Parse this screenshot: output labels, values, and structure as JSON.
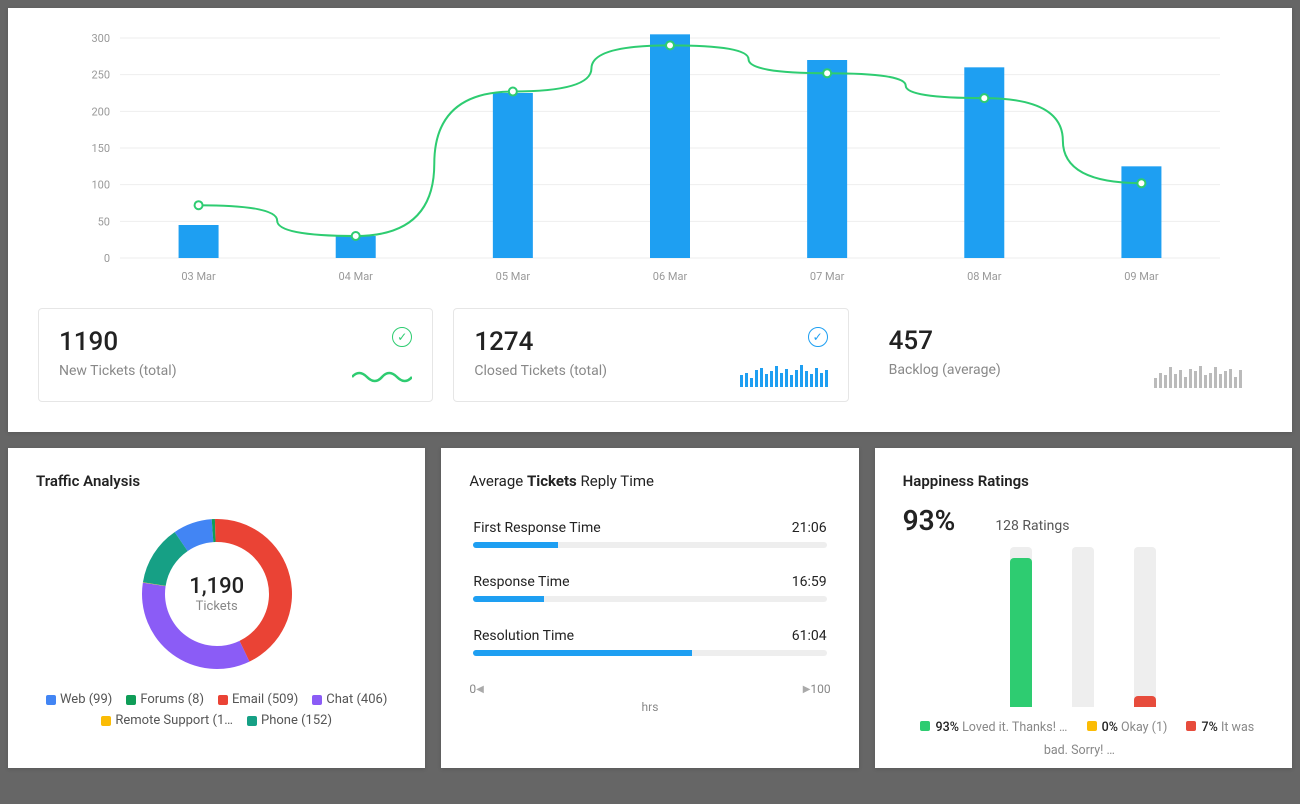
{
  "chart_data": {
    "main_chart": {
      "type": "bar+line",
      "categories": [
        "03 Mar",
        "04 Mar",
        "05 Mar",
        "06 Mar",
        "07 Mar",
        "08 Mar",
        "09 Mar"
      ],
      "ylim": [
        0,
        300
      ],
      "yticks": [
        0,
        50,
        100,
        150,
        200,
        250,
        300
      ],
      "series": [
        {
          "name": "bars",
          "type": "bar",
          "color": "#1e9ff2",
          "values": [
            45,
            30,
            225,
            305,
            270,
            260,
            125
          ]
        },
        {
          "name": "line",
          "type": "line",
          "color": "#2ecc71",
          "values": [
            72,
            30,
            227,
            290,
            252,
            218,
            102
          ]
        }
      ]
    },
    "traffic_donut": {
      "type": "pie",
      "title": "Traffic Analysis",
      "total_value": "1,190",
      "total_label": "Tickets",
      "slices": [
        {
          "label": "Web",
          "count": 99,
          "color": "#4285f4"
        },
        {
          "label": "Forums",
          "count": 8,
          "color": "#0f9d58"
        },
        {
          "label": "Email",
          "count": 509,
          "color": "#ea4335"
        },
        {
          "label": "Chat",
          "count": 406,
          "color": "#8b5cf6"
        },
        {
          "label": "Remote Support",
          "count": 1,
          "color": "#fbbc05",
          "display": "Remote Support (1…"
        },
        {
          "label": "Phone",
          "count": 152,
          "color": "#16a085"
        }
      ]
    },
    "happiness": {
      "type": "bar",
      "categories": [
        "Loved",
        "Okay",
        "Bad"
      ],
      "values": [
        93,
        0,
        7
      ],
      "colors": [
        "#2ecc71",
        "#fbbc05",
        "#e74c3c"
      ],
      "ylim": [
        0,
        100
      ]
    }
  },
  "stats": {
    "new_tickets": {
      "value": "1190",
      "label": "New Tickets (total)",
      "spark_color": "#2ecc71",
      "check": "green"
    },
    "closed_tickets": {
      "value": "1274",
      "label": "Closed  Tickets (total)",
      "spark_color": "#1e9ff2",
      "check": "blue",
      "spark_bars": [
        8,
        10,
        6,
        12,
        14,
        9,
        11,
        15,
        10,
        13,
        8,
        12,
        16,
        11,
        9,
        14,
        10,
        12
      ]
    },
    "backlog": {
      "value": "457",
      "label": "Backlog (average)",
      "spark_color": "#bbbbbb",
      "spark_bars": [
        6,
        10,
        8,
        14,
        9,
        12,
        7,
        13,
        11,
        15,
        8,
        10,
        14,
        9,
        11,
        13,
        7,
        12
      ]
    }
  },
  "reply_time": {
    "title_prefix": "Average",
    "title_bold": "Tickets",
    "title_suffix": "Reply Time",
    "rows": [
      {
        "label": "First Response Time",
        "value": "21:06",
        "pct": 24
      },
      {
        "label": "Response Time",
        "value": "16:59",
        "pct": 20
      },
      {
        "label": "Resolution Time",
        "value": "61:04",
        "pct": 62
      }
    ],
    "scale_min": "0",
    "scale_max": "100",
    "scale_unit": "hrs"
  },
  "happiness": {
    "title": "Happiness Ratings",
    "pct": "93%",
    "ratings_count": "128 Ratings",
    "legend": [
      {
        "color": "#2ecc71",
        "pct": "93%",
        "text": "Loved it. Thanks! …"
      },
      {
        "color": "#fbbc05",
        "pct": "0%",
        "text": "Okay (1)"
      },
      {
        "color": "#e74c3c",
        "pct": "7%",
        "text": "It was bad. Sorry! …"
      }
    ]
  },
  "traffic_title": "Traffic Analysis"
}
